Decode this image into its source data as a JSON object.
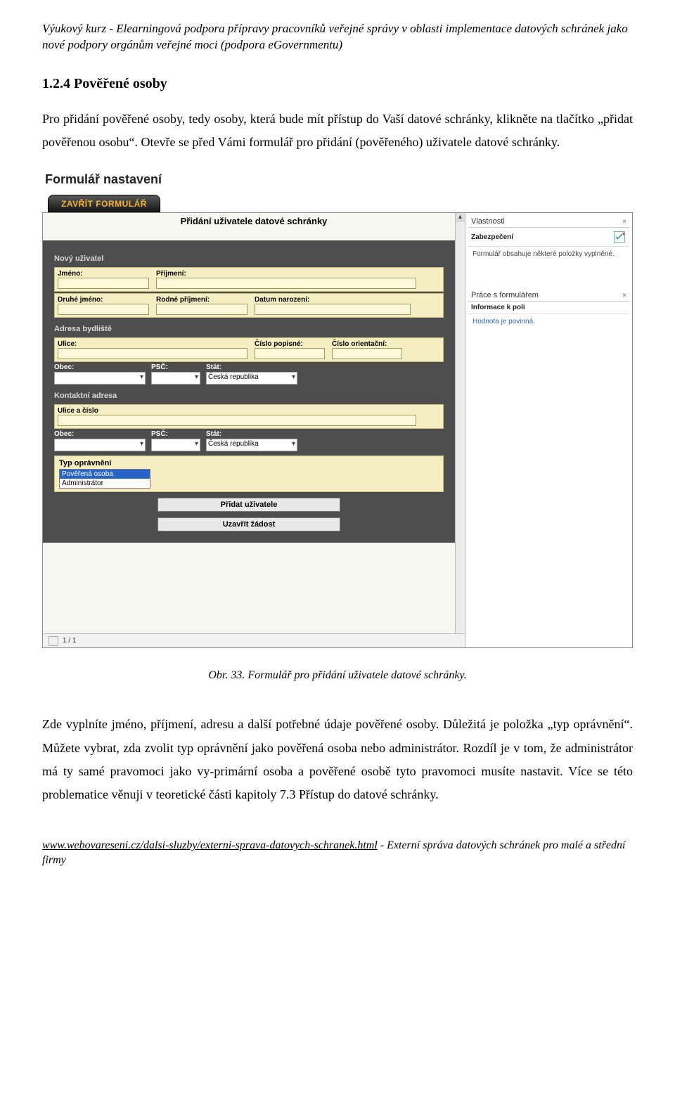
{
  "header": {
    "line1": "Výukový kurz - Elearningová podpora přípravy pracovníků veřejné správy v oblasti implementace datových schránek jako nové podpory orgánům veřejné moci (podpora eGovernmentu)"
  },
  "section": {
    "number_title": "1.2.4   Pověřené osoby",
    "para1": "Pro přidání pověřené osoby, tedy osoby, která bude mít přístup do Vaší datové schránky, klikněte na tlačítko „přidat pověřenou osobu“. Otevře se před Vámi formulář pro přidání (pověřeného) uživatele datové schránky."
  },
  "screenshot": {
    "outer_title": "Formulář nastavení",
    "close_tab": "ZAVŘÍT FORMULÁŘ",
    "form_heading": "Přidání uživatele datové schránky",
    "sec_new_user": "Nový uživatel",
    "lbl_jmeno": "Jméno:",
    "lbl_prijmeni": "Příjmení:",
    "lbl_druhe": "Druhé jméno:",
    "lbl_rodne": "Rodné příjmení:",
    "lbl_datum": "Datum narození:",
    "sec_adresa": "Adresa bydliště",
    "lbl_ulice": "Ulice:",
    "lbl_cp": "Číslo popisné:",
    "lbl_co": "Číslo orientační:",
    "lbl_obec": "Obec:",
    "lbl_psc": "PSČ:",
    "lbl_stat": "Stát:",
    "stat_default": "Česká republika",
    "sec_kontakt": "Kontaktní adresa",
    "lbl_ulice_cislo": "Ulice a číslo",
    "sec_typ": "Typ oprávnění",
    "perm_selected": "Pověřená osoba",
    "perm_other": "Administrátor",
    "btn_add": "Přidat uživatele",
    "btn_close": "Uzavřít žádost",
    "side": {
      "p1_title": "Vlastnosti",
      "p1_sub": "Zabezpečení",
      "p1_txt": "Formulář obsahuje některé položky vyplněné.",
      "p2_title": "Práce s formulářem",
      "p2_sub": "Informace k poli",
      "p2_txt": "Hodnota je povinná."
    },
    "page_indicator": "1 / 1"
  },
  "caption": "Obr. 33. Formulář pro přidání uživatele datové schránky.",
  "para2": "Zde vyplníte jméno, příjmení, adresu a další potřebné údaje pověřené osoby. Důležitá je položka „typ oprávnění“. Můžete vybrat, zda zvolit typ oprávnění jako pověřená osoba nebo administrátor. Rozdíl je v tom, že administrátor má ty samé pravomoci jako vy-primární osoba a pověřené osobě tyto pravomoci musíte nastavit. Více se této problematice věnuji v teoretické části kapitoly 7.3 Přístup do datové schránky.",
  "footer": {
    "url": "www.webovareseni.cz/dalsi-sluzby/externi-sprava-datovych-schranek.html",
    "tail": " - Externí správa datových schránek pro malé a střední firmy"
  }
}
